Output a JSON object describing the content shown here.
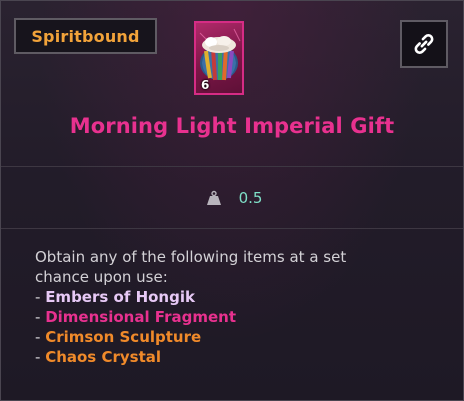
{
  "tag": {
    "label": "Spiritbound"
  },
  "item": {
    "icon_name": "gift-pouch-icon",
    "stack_count": "6",
    "title": "Morning Light Imperial Gift",
    "title_color": "#e8318f"
  },
  "link_button": {
    "icon_name": "link-icon"
  },
  "weight": {
    "icon_name": "weight-icon",
    "value": "0.5"
  },
  "description": {
    "line1": "Obtain any of the following items at a set",
    "line2": "chance upon use:",
    "dash": "- ",
    "rewards": [
      {
        "name": "Embers of Hongik",
        "color": "#e7c9f6"
      },
      {
        "name": "Dimensional Fragment",
        "color": "#e8318f"
      },
      {
        "name": "Crimson Sculpture",
        "color": "#f08a2a"
      },
      {
        "name": "Chaos Crystal",
        "color": "#f08a2a"
      }
    ]
  }
}
